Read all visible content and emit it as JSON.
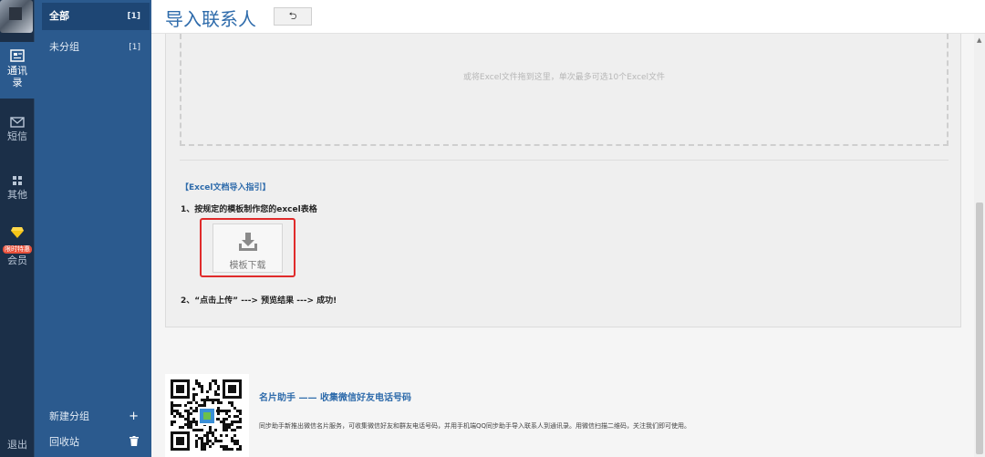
{
  "nav": {
    "contacts": "通讯录",
    "sms": "短信",
    "other": "其他",
    "vip_badge": "限时特惠",
    "member": "会员",
    "logout": "退出",
    "active_color": "#2b5a8e"
  },
  "groups": {
    "items": [
      {
        "label": "全部",
        "count": "[1]"
      },
      {
        "label": "未分组",
        "count": "[1]"
      }
    ],
    "new_group": "新建分组",
    "recycle": "回收站",
    "new_group_icon": "plus-icon",
    "recycle_icon": "trash-icon"
  },
  "header": {
    "title": "导入联系人",
    "back_button": "⮌"
  },
  "dropzone": {
    "hint": "或将Excel文件拖到这里，单次最多可选10个Excel文件"
  },
  "guide": {
    "title": "【Excel文档导入指引】",
    "step1": "1、按规定的模板制作您的excel表格",
    "template_button": "模板下载",
    "step2": "2、“点击上传” ---> 预览结果 ---> 成功!"
  },
  "promo": {
    "title": "名片助手 —— 收集微信好友电话号码",
    "description": "同步助手新推出微信名片服务，可收集微信好友和群友电话号码，并用手机端QQ同步助手导入联系人到通讯录。用微信扫描二维码，关注我们即可使用。"
  }
}
